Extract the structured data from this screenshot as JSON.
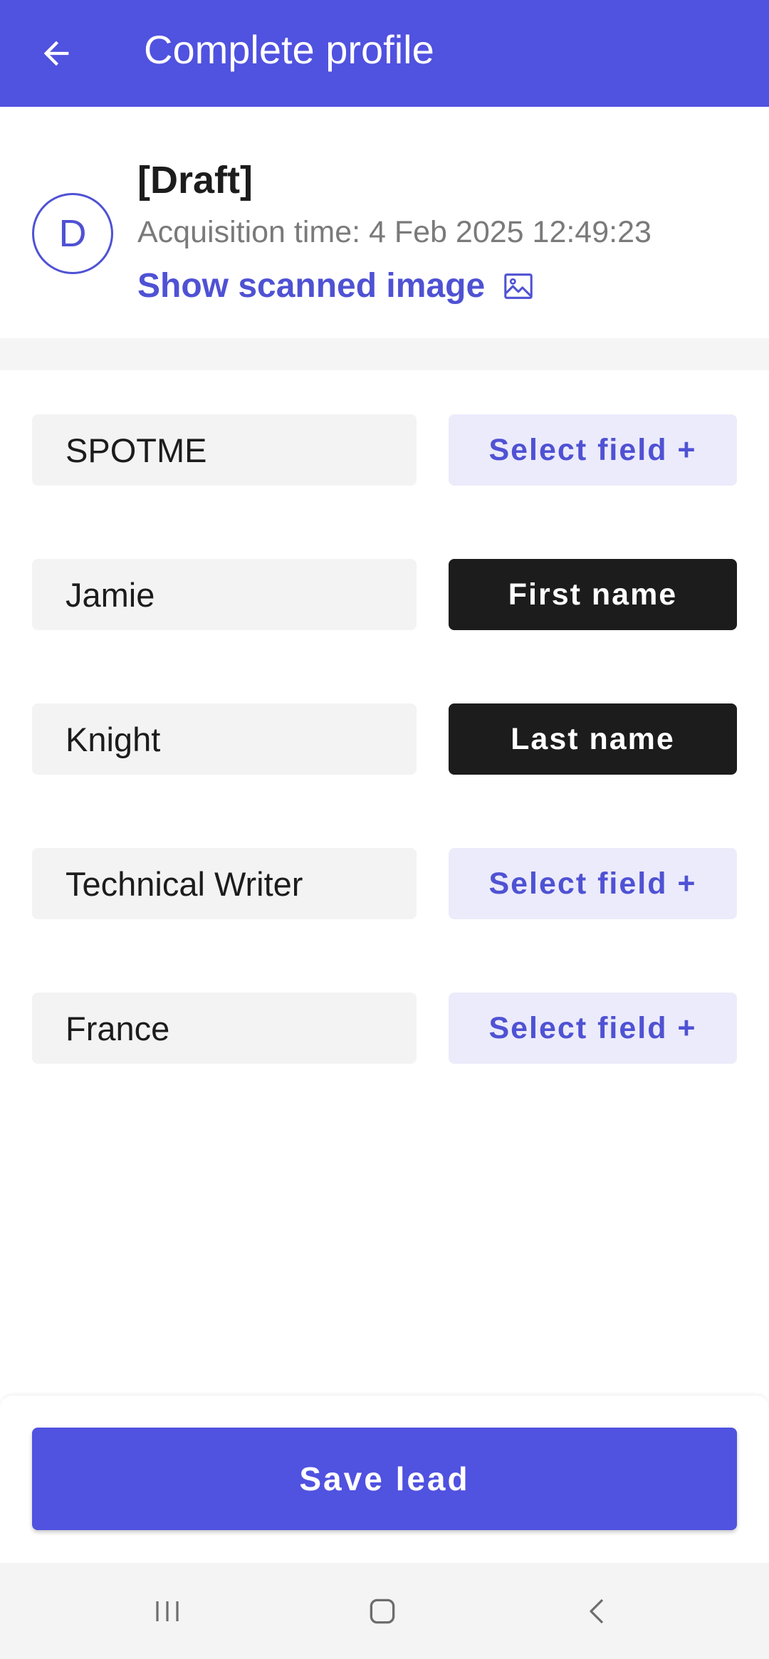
{
  "app_bar": {
    "title": "Complete profile",
    "back_icon": "arrow-left-icon",
    "background": "#5052e0"
  },
  "profile": {
    "avatar_letter": "D",
    "title": "[Draft]",
    "acquisition_time": "Acquisition time: 4 Feb 2025 12:49:23",
    "show_image_label": "Show scanned image",
    "show_image_icon": "image-icon"
  },
  "rows": [
    {
      "value": "SPOTME",
      "field_label": "Select field +",
      "selected": false
    },
    {
      "value": "Jamie",
      "field_label": "First name",
      "selected": true
    },
    {
      "value": "Knight",
      "field_label": "Last name",
      "selected": true
    },
    {
      "value": "Technical Writer",
      "field_label": "Select field +",
      "selected": false
    },
    {
      "value": "France",
      "field_label": "Select field +",
      "selected": false
    }
  ],
  "footer": {
    "save_label": "Save lead"
  },
  "nav": {
    "recents_icon": "recents-icon",
    "home_icon": "home-icon",
    "back_icon": "back-chevron-icon"
  },
  "colors": {
    "accent": "#5052e0",
    "accent_text": "#4f52d3",
    "chip_bg": "#ecebfb",
    "selected_bg": "#1c1c1c",
    "field_bg": "#f3f3f3"
  }
}
